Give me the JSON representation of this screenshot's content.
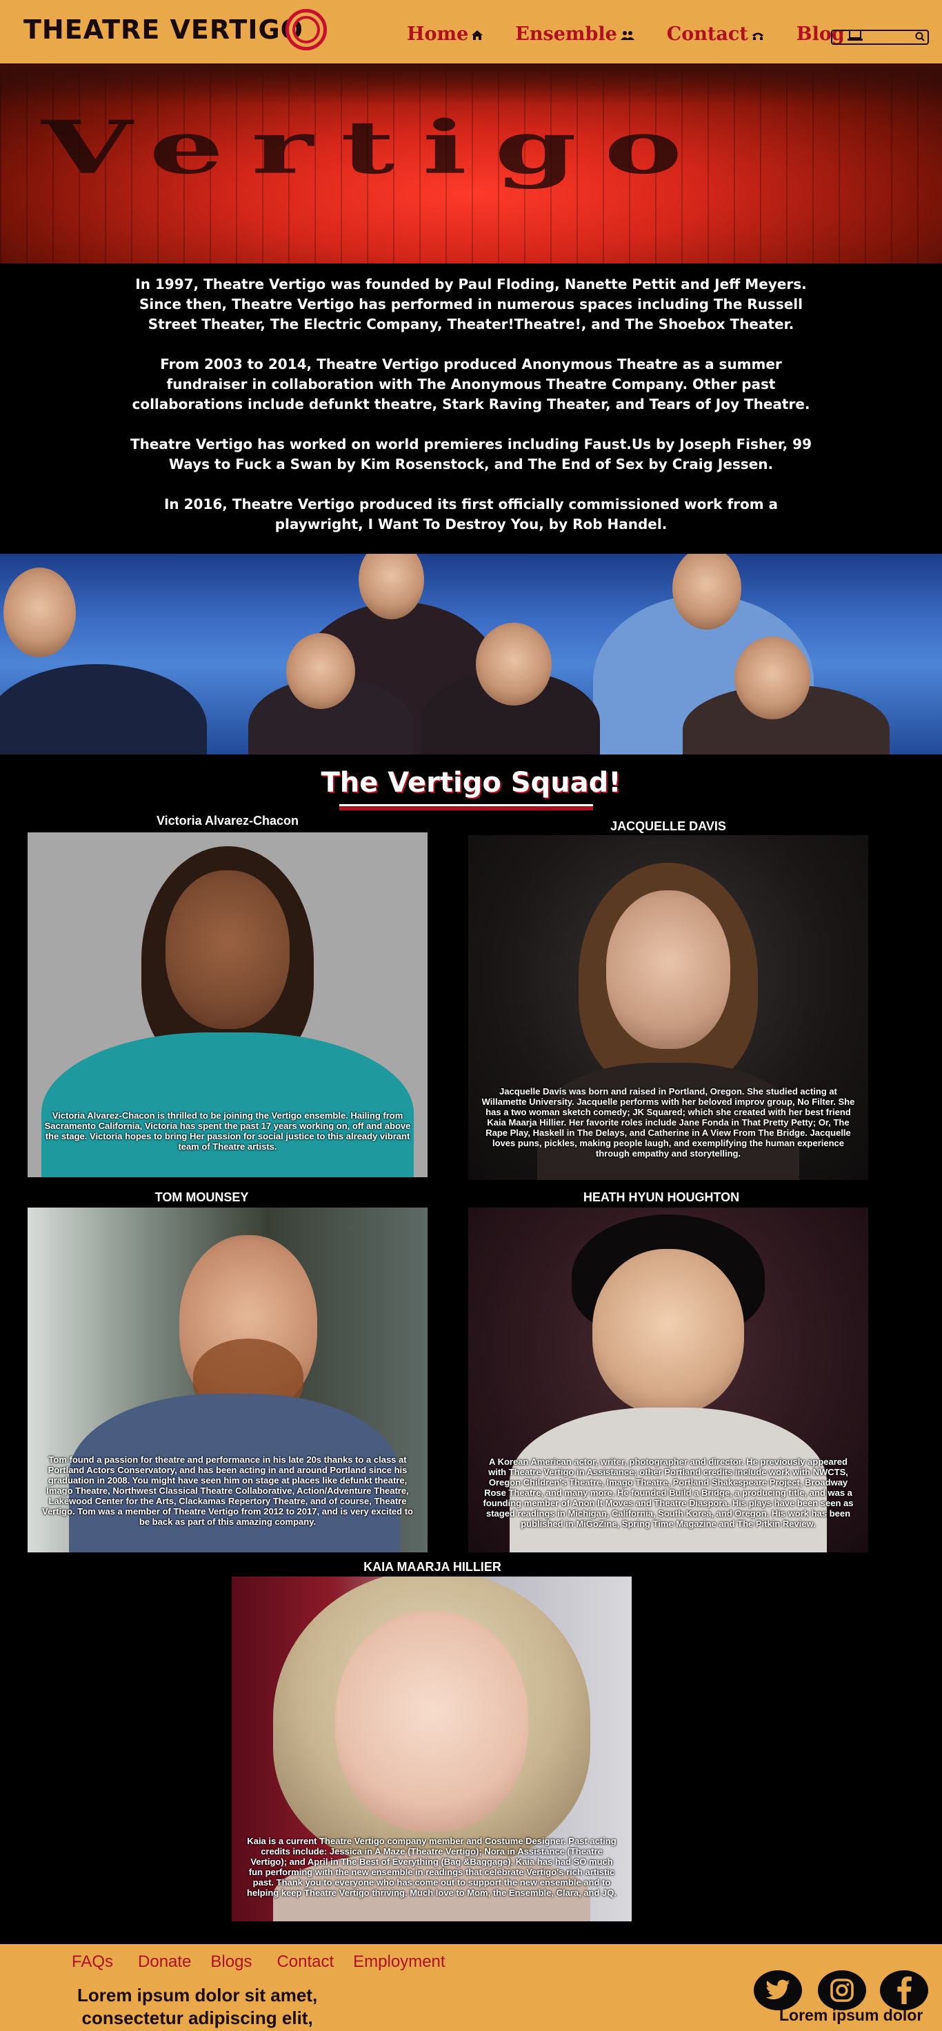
{
  "header": {
    "logo_text": "THEATRE VERTIGO",
    "nav": [
      {
        "label": "Home",
        "icon": "home-icon"
      },
      {
        "label": "Ensemble",
        "icon": "people-icon"
      },
      {
        "label": "Contact",
        "icon": "phone-icon"
      },
      {
        "label": "Blog",
        "icon": "laptop-icon"
      }
    ],
    "search_placeholder": ""
  },
  "hero": {
    "word": "Vertigo"
  },
  "intro": {
    "paragraphs": [
      "In 1997, Theatre Vertigo was founded by Paul Floding, Nanette Pettit and Jeff Meyers.  Since then, Theatre Vertigo has performed in numerous spaces including The Russell Street Theater, The Electric Company, Theater!Theatre!, and The Shoebox Theater.",
      "From 2003 to 2014, Theatre Vertigo produced Anonymous Theatre as a summer fundraiser in collaboration with The Anonymous Theatre Company.  Other past collaborations include defunkt theatre, Stark Raving Theater, and Tears of Joy Theatre.",
      "Theatre Vertigo has worked on world premieres including Faust.Us by Joseph Fisher, 99 Ways to Fuck a Swan by Kim Rosenstock, and The End of Sex by Craig Jessen.",
      "In 2016, Theatre Vertigo produced its first officially commissioned work from a playwright, I Want To Destroy You, by Rob Handel."
    ]
  },
  "squad": {
    "title": "The Vertigo Squad!",
    "members": [
      {
        "name": "Victoria Alvarez-Chacon",
        "bio": "Victoria Alvarez-Chacon is thrilled to be joining the Vertigo ensemble. Hailing from Sacramento California, Victoria has spent the past 17 years working on, off and above the stage. Victoria hopes to bring Her passion for social justice to this already vibrant team of Theatre artists."
      },
      {
        "name": "JACQUELLE DAVIS",
        "bio": "Jacquelle Davis was born and raised in Portland, Oregon. She studied acting at Willamette University. Jacquelle performs with her beloved improv group, No Filter. She has a two woman sketch comedy; JK Squared; which she created with her best friend Kaia Maarja Hillier.  Her favorite roles include Jane Fonda in That Pretty Petty; Or, The Rape Play, Haskell in The Delays, and Catherine in A View From The Bridge. Jacquelle loves puns, pickles, making people laugh, and exemplifying the human experience through empathy and storytelling."
      },
      {
        "name": "TOM MOUNSEY",
        "bio": "Tom found a passion for theatre and performance in his late 20s thanks to a class at Portland Actors Conservatory, and has been acting in and around Portland since his graduation in 2008. You might have seen him on stage at places like defunkt theatre, Imago Theatre, Northwest Classical Theatre Collaborative, Action/Adventure Theatre, Lakewood Center for the Arts, Clackamas Repertory Theatre, and of course, Theatre Vertigo. Tom was a member of Theatre Vertigo from 2012 to 2017, and is very excited to be back as part of this amazing company."
      },
      {
        "name": "HEATH HYUN HOUGHTON",
        "bio": "A Korean American actor, writer, photographer and director.  He previously appeared with Theatre Vertigo in Assistance; other Portland credits include work with NWCTS, Oregon Children's Theatre, Imago Theatre, Portland Shakespeare Project, Broadway Rose Theatre, and many more.  He founded Build a Bridge, a producing title, and was a founding member of Anon It Moves and Theatre Diaspora.  His plays have been seen as staged readings in Michigan, California, South Korea, and Oregon.  His work has been published in MiGoZine, Spring Time Magazine and The Pitkin Review."
      },
      {
        "name": "KAIA MAARJA HILLIER",
        "bio": "Kaia is a current Theatre Vertigo company member and Costume Designer. Past acting credits include: Jessica in A Maze (Theatre Vertigo); Nora in Assistance (Theatre Vertigo); and April in The Best of Everything (Bag &Baggage). Kaia has had SO much fun performing with the new ensemble in readings that celebrate Vertigo's rich artistic past. Thank you to everyone who has come out to support the new ensemble and to helping keep Theatre Vertigo thriving. Much love to Mom, the Ensemble, Clara, and JQ."
      }
    ]
  },
  "footer": {
    "links": [
      "FAQs",
      "Donate",
      "Blogs",
      "Contact",
      "Employment"
    ],
    "lorem_left_1": "Lorem ipsum dolor sit amet,",
    "lorem_left_2": "consectetur adipiscing elit,",
    "lorem_right": "Lorem ipsum dolor",
    "social": [
      "twitter-icon",
      "instagram-icon",
      "facebook-icon"
    ]
  },
  "colors": {
    "header_bg": "#e9a94a",
    "accent_red": "#b01020",
    "page_bg": "#000000"
  }
}
